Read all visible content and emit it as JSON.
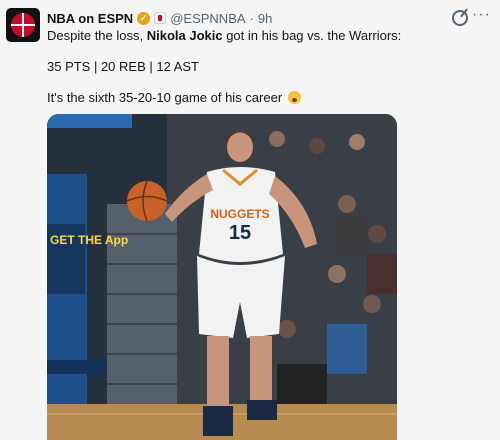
{
  "tweet": {
    "author_name": "NBA on ESPN",
    "handle": "@ESPNNBA",
    "separator": "·",
    "time": "9h",
    "line1_prefix": "Despite the loss, ",
    "line1_mention": "Nikola Jokic",
    "line1_suffix": " got in his bag vs. the Warriors:",
    "stats": "35 PTS | 20 REB | 12 AST",
    "line3": "It's the sixth 35-20-10 game of his career"
  },
  "media": {
    "jersey_team": "NUGGETS",
    "jersey_number": "15",
    "ad_text": "GET THE App"
  },
  "icons": {
    "avatar": "nba-logo-icon",
    "verified": "verified-badge-icon",
    "affiliate": "espn-affiliate-icon",
    "grok": "grok-icon",
    "more": "more-options-icon",
    "emoji": "exploding-head-emoji-icon"
  },
  "colors": {
    "accent": "#c9082a",
    "verified": "#e8a317",
    "muted_text": "#536471"
  }
}
